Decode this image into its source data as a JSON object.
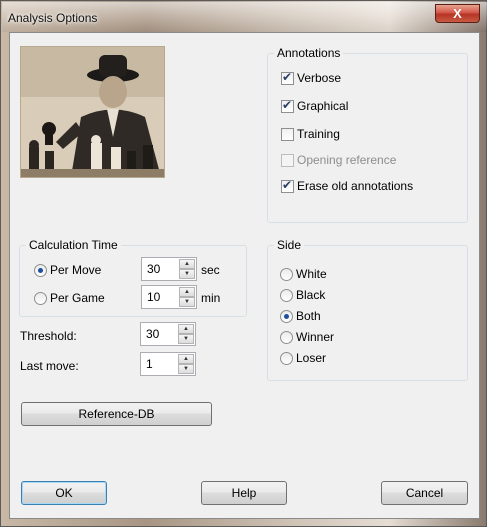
{
  "window": {
    "title": "Analysis Options",
    "close_glyph": "X"
  },
  "annotations": {
    "label": "Annotations",
    "items": [
      {
        "label": "Verbose",
        "checked": true,
        "disabled": false
      },
      {
        "label": "Graphical",
        "checked": true,
        "disabled": false
      },
      {
        "label": "Training",
        "checked": false,
        "disabled": false
      },
      {
        "label": "Opening reference",
        "checked": false,
        "disabled": true
      },
      {
        "label": "Erase old annotations",
        "checked": true,
        "disabled": false
      }
    ]
  },
  "calculation_time": {
    "label": "Calculation Time",
    "per_move": {
      "label": "Per Move",
      "value": "30",
      "unit": "sec",
      "selected": true
    },
    "per_game": {
      "label": "Per Game",
      "value": "10",
      "unit": "min",
      "selected": false
    }
  },
  "threshold": {
    "label": "Threshold:",
    "value": "30"
  },
  "last_move": {
    "label": "Last move:",
    "value": "1"
  },
  "side": {
    "label": "Side",
    "options": [
      "White",
      "Black",
      "Both",
      "Winner",
      "Loser"
    ],
    "selected": "Both"
  },
  "buttons": {
    "reference_db": "Reference-DB",
    "ok": "OK",
    "help": "Help",
    "cancel": "Cancel"
  }
}
